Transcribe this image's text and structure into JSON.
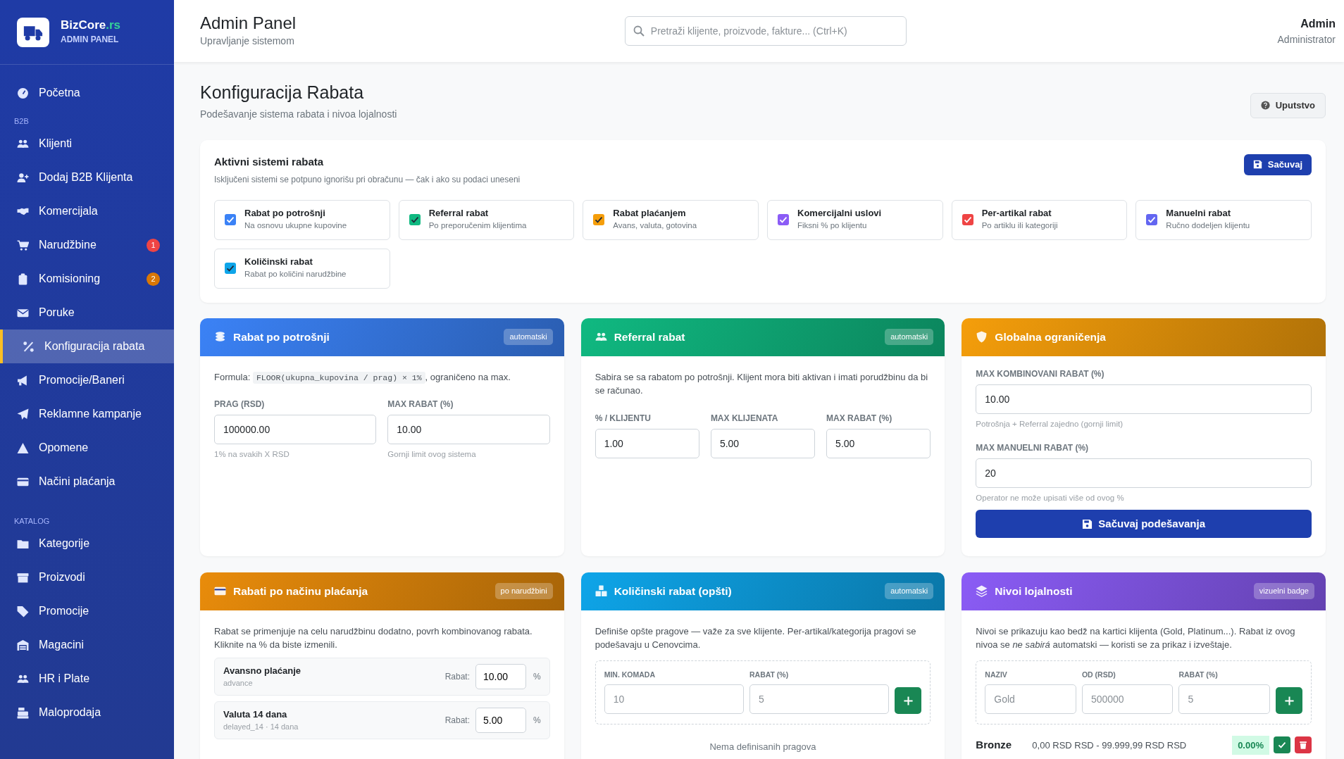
{
  "brand": {
    "name": "BizCore",
    "tld": ".rs",
    "subtitle": "ADMIN PANEL"
  },
  "sidebar": {
    "items": [
      {
        "kind": "link",
        "label": "Početna",
        "selected": false
      },
      {
        "kind": "heading",
        "label": "B2B"
      },
      {
        "kind": "link",
        "label": "Klijenti",
        "selected": false
      },
      {
        "kind": "link",
        "label": "Dodaj B2B Klijenta",
        "selected": false
      },
      {
        "kind": "link",
        "label": "Komercijala",
        "selected": false
      },
      {
        "kind": "link",
        "label": "Narudžbine",
        "selected": false,
        "badge": "1",
        "color": "#ef4444"
      },
      {
        "kind": "link",
        "label": "Komisioning",
        "selected": false,
        "badge": "2",
        "color": "#d97706"
      },
      {
        "kind": "link",
        "label": "Poruke",
        "selected": false
      },
      {
        "kind": "link",
        "label": "Konfiguracija rabata",
        "selected": true
      },
      {
        "kind": "link",
        "label": "Promocije/Baneri",
        "selected": false
      },
      {
        "kind": "link",
        "label": "Reklamne kampanje",
        "selected": false
      },
      {
        "kind": "link",
        "label": "Opomene",
        "selected": false
      },
      {
        "kind": "link",
        "label": "Načini plaćanja",
        "selected": false
      },
      {
        "kind": "heading",
        "label": "KATALOG"
      },
      {
        "kind": "link",
        "label": "Kategorije",
        "selected": false
      },
      {
        "kind": "link",
        "label": "Proizvodi",
        "selected": false
      },
      {
        "kind": "link",
        "label": "Promocije",
        "selected": false
      },
      {
        "kind": "link",
        "label": "Magacini",
        "selected": false
      },
      {
        "kind": "link",
        "label": "HR i Plate",
        "selected": false
      },
      {
        "kind": "link",
        "label": "Maloprodaja",
        "selected": false
      }
    ]
  },
  "header": {
    "title": "Admin Panel",
    "subtitle": "Upravljanje sistemom",
    "search": {
      "placeholder": "Pretraži klijente, proizvode, fakture... (Ctrl+K)"
    },
    "user": {
      "name": "Admin",
      "role": "Administrator"
    }
  },
  "page": {
    "title": "Konfiguracija Rabata",
    "subtitle": "Podešavanje sistema rabata i nivoa lojalnosti",
    "help_button": "Uputstvo"
  },
  "active_systems": {
    "title": "Aktivni sistemi rabata",
    "description": "Isključeni sistemi se potpuno ignorišu pri obračunu — čak i ako su podaci uneseni",
    "save_button": "Sačuvaj",
    "options": [
      {
        "title": "Rabat po potrošnji",
        "description": "Na osnovu ukupne kupovine",
        "checked": true,
        "color": "#3b82f6"
      },
      {
        "title": "Referral rabat",
        "description": "Po preporučenim klijentima",
        "checked": true,
        "color": "#10b981"
      },
      {
        "title": "Rabat plaćanjem",
        "description": "Avans, valuta, gotovina",
        "checked": true,
        "color": "#f59e0b"
      },
      {
        "title": "Komercijalni uslovi",
        "description": "Fiksni % po klijentu",
        "checked": true,
        "color": "#8b5cf6"
      },
      {
        "title": "Per-artikal rabat",
        "description": "Po artiklu ili kategoriji",
        "checked": true,
        "color": "#ef4444"
      },
      {
        "title": "Manuelni rabat",
        "description": "Ručno dodeljen klijentu",
        "checked": true,
        "color": "#6366f1"
      },
      {
        "title": "Količinski rabat",
        "description": "Rabat po količini narudžbine",
        "checked": true,
        "color": "#0ea5e9"
      }
    ]
  },
  "panels": [
    {
      "kind": "spend",
      "title": "Rabat po potrošnji",
      "badge": "automatski",
      "color": "#3b82f6",
      "formula_label": "Formula:",
      "formula_code": "FLOOR(ukupna_kupovina / prag) × 1%",
      "formula_suffix": ", ograničeno na max.",
      "fields": [
        {
          "label": "PRAG (RSD)",
          "value": "100000.00",
          "help": "1% na svakih X RSD"
        },
        {
          "label": "MAX RABAT (%)",
          "value": "10.00",
          "help": "Gornji limit ovog sistema"
        }
      ]
    },
    {
      "kind": "referral",
      "title": "Referral rabat",
      "badge": "automatski",
      "color": "#10b981",
      "description": "Sabira se sa rabatom po potrošnji. Klijent mora biti aktivan i imati porudžbinu da bi se računao.",
      "fields": [
        {
          "label": "% / KLIJENTU",
          "value": "1.00"
        },
        {
          "label": "MAX KLIJENATA",
          "value": "5.00"
        },
        {
          "label": "MAX RABAT (%)",
          "value": "5.00"
        }
      ]
    },
    {
      "kind": "global",
      "title": "Globalna ograničenja",
      "color": "#f59e0b",
      "fields": [
        {
          "label": "MAX KOMBINOVANI RABAT (%)",
          "value": "10.00",
          "help": "Potrošnja + Referral zajedno (gornji limit)"
        },
        {
          "label": "MAX MANUELNI RABAT (%)",
          "value": "20",
          "help": "Operator ne može upisati više od ovog %"
        }
      ],
      "button": "Sačuvaj podešavanja"
    },
    {
      "kind": "payment",
      "title": "Rabati po načinu plaćanja",
      "badge": "po narudžbini",
      "color": "#e98c0b",
      "description": "Rabat se primenjuje na celu narudžbinu dodatno, povrh kombinovanog rabata. Kliknite na % da biste izmenili.",
      "methods": [
        {
          "name": "Avansno plaćanje",
          "code": "advance",
          "rate_label": "Rabat:",
          "value": "10.00",
          "unit": "%"
        },
        {
          "name": "Valuta 14 dana",
          "code": "delayed_14 · 14 dana",
          "rate_label": "Rabat:",
          "value": "5.00",
          "unit": "%"
        }
      ]
    },
    {
      "kind": "quantity",
      "title": "Količinski rabat (opšti)",
      "badge": "automatski",
      "color": "#0ea5e9",
      "description": "Definiše opšte pragove — važe za sve klijente. Per-artikal/kategorija pragovi se podešavaju u Cenovcima.",
      "fields": [
        {
          "label": "MIN. KOMADA",
          "placeholder": "10"
        },
        {
          "label": "RABAT (%)",
          "placeholder": "5"
        }
      ],
      "empty_text": "Nema definisanih pragova"
    },
    {
      "kind": "loyalty",
      "title": "Nivoi lojalnosti",
      "badge": "vizuelni badge",
      "color": "#8b5cf6",
      "description": "Nivoi se prikazuju kao bedž na kartici klijenta (Gold, Platinum...). Rabat iz ovog nivoa se *ne sabirá* automatski — koristi se za prikaz i izveštaje.",
      "fields": [
        {
          "label": "NAZIV",
          "placeholder": "Gold"
        },
        {
          "label": "OD (RSD)",
          "placeholder": "500000"
        },
        {
          "label": "RABAT (%)",
          "placeholder": "5"
        }
      ],
      "tiers": [
        {
          "name": "Bronze",
          "range": "0,00 RSD RSD - 99.999,99 RSD RSD",
          "rate": "0.00%"
        }
      ]
    }
  ]
}
